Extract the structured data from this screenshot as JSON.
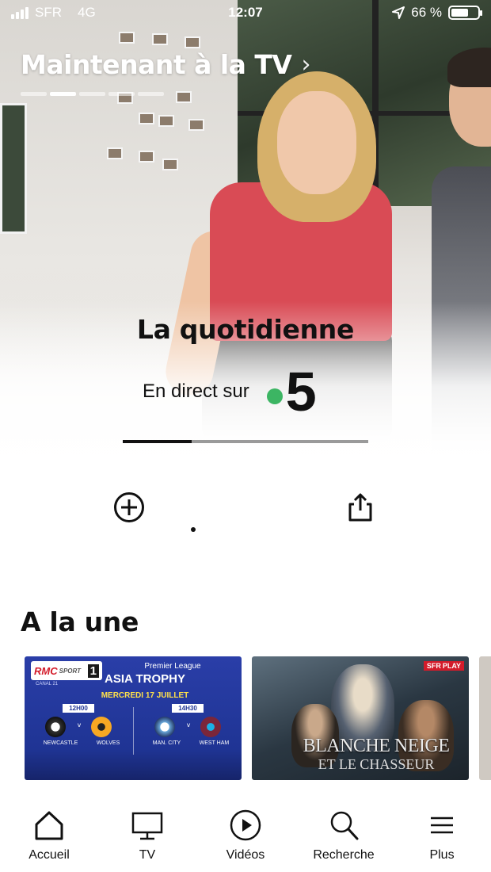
{
  "status_bar": {
    "carrier": "SFR",
    "network": "4G",
    "time": "12:07",
    "battery": "66 %",
    "battery_level": 0.66
  },
  "hero": {
    "section_title": "Maintenant à la TV",
    "page_count": 5,
    "active_page": 1,
    "show_title": "La quotidienne",
    "live_label": "En direct sur",
    "channel_number": "5",
    "channel_dot_color": "#3cb563",
    "progress": 0.28
  },
  "a_la_une": {
    "title": "A la une",
    "cards": [
      {
        "badge_text": "RMC",
        "badge_sub": "SPORT",
        "badge_number": "1",
        "badge_caption": "CANAL 21",
        "league": "Premier League",
        "event": "ASIA TROPHY",
        "date": "MERCREDI 17 JUILLET",
        "matches": [
          {
            "time": "12H00",
            "home": "NEWCASTLE",
            "away": "WOLVES",
            "vs": "v"
          },
          {
            "time": "14H30",
            "home": "MAN. CITY",
            "away": "WEST HAM",
            "vs": "v"
          }
        ]
      },
      {
        "badge_text": "SFR",
        "badge_sub": "PLAY",
        "title_line1": "BLANCHE NEIGE",
        "title_line2": "ET LE CHASSEUR"
      }
    ]
  },
  "tabbar": {
    "items": [
      {
        "label": "Accueil",
        "icon": "home-icon"
      },
      {
        "label": "TV",
        "icon": "tv-icon"
      },
      {
        "label": "Vidéos",
        "icon": "play-icon"
      },
      {
        "label": "Recherche",
        "icon": "search-icon"
      },
      {
        "label": "Plus",
        "icon": "menu-icon"
      }
    ]
  },
  "colors": {
    "accent_green": "#3cb563",
    "rmc_red": "#d31b2a",
    "card_blue": "#1f3494"
  }
}
